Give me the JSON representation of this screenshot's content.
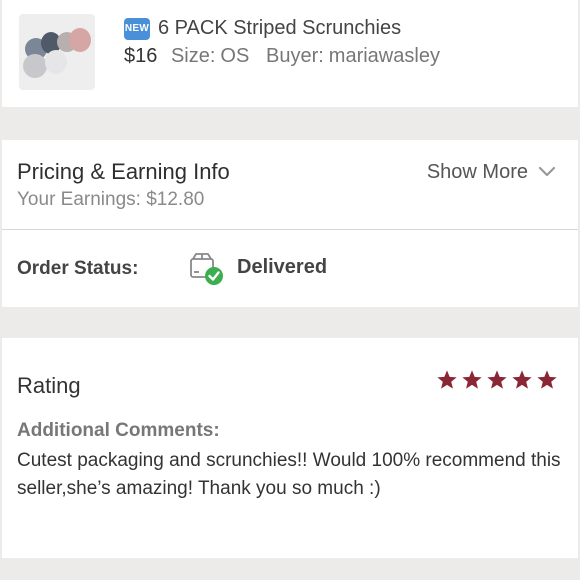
{
  "listing": {
    "badge": "NEW",
    "title": "6 PACK Striped Scrunchies",
    "price": "$16",
    "size_label": "Size:",
    "size_value": "OS",
    "buyer_label": "Buyer:",
    "buyer_value": "mariawasley"
  },
  "pricing": {
    "title": "Pricing & Earning Info",
    "earnings_label": "Your Earnings:",
    "earnings_value": "$12.80",
    "show_more": "Show More"
  },
  "order_status": {
    "label": "Order Status:",
    "value": "Delivered"
  },
  "review": {
    "rating_label": "Rating",
    "rating": 5,
    "rating_max": 5,
    "star_color": "#8b2635",
    "comments_label": "Additional Comments:",
    "comment": "Cutest packaging and scrunchies!! Would 100% recommend this seller,she’s amazing! Thank you so much :)"
  },
  "colors": {
    "background": "#ecebe9",
    "panel": "#ffffff",
    "badge": "#4a90d9",
    "delivered_check": "#3cae4f"
  }
}
